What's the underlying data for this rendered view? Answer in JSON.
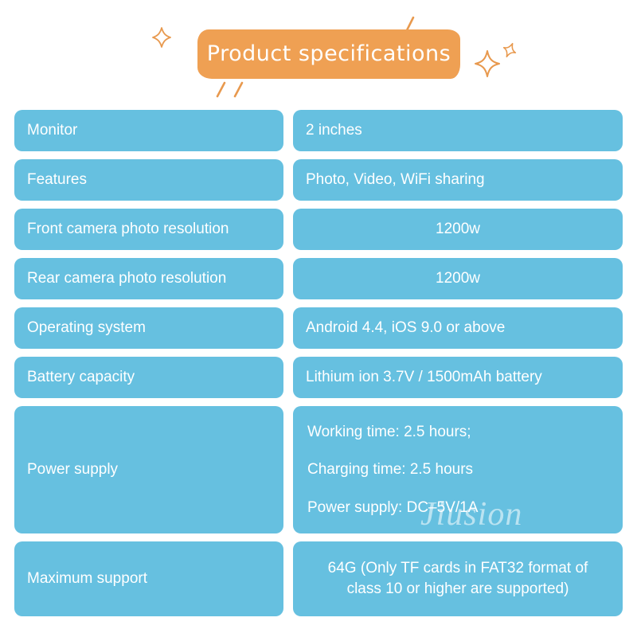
{
  "header": {
    "title": "Product specifications",
    "banner_color": "#efa053",
    "title_color": "#ffffff",
    "decorations": [
      "diamond-outline-left",
      "tick-stroke-top",
      "tick-strokes-bottom-left",
      "four-point-star-right",
      "small-diamond-outline-right"
    ]
  },
  "theme": {
    "cell_color": "#66c0e0",
    "text_color": "#ffffff",
    "background": "#ffffff"
  },
  "watermark": {
    "text": "Jiusion"
  },
  "spec_table": {
    "rows": [
      {
        "label": "Monitor",
        "value": "2 inches",
        "align": "left",
        "size": "std"
      },
      {
        "label": "Features",
        "value": "Photo, Video, WiFi sharing",
        "align": "left",
        "size": "std"
      },
      {
        "label": "Front camera photo resolution",
        "value": "1200w",
        "align": "center",
        "size": "std"
      },
      {
        "label": "Rear camera photo resolution",
        "value": "1200w",
        "align": "center",
        "size": "std"
      },
      {
        "label": "Operating system",
        "value": "Android 4.4, iOS 9.0 or above",
        "align": "left",
        "size": "std"
      },
      {
        "label": "Battery capacity",
        "value": "Lithium ion 3.7V / 1500mAh battery",
        "align": "left",
        "size": "std"
      }
    ],
    "power_supply": {
      "label": "Power supply",
      "lines": [
        "Working time: 2.5 hours;",
        "Charging time: 2.5 hours",
        "Power supply: DC–5V/1A"
      ]
    },
    "maximum_support": {
      "label": "Maximum support",
      "value": "64G (Only TF cards in FAT32 format of class 10 or higher are supported)"
    }
  }
}
